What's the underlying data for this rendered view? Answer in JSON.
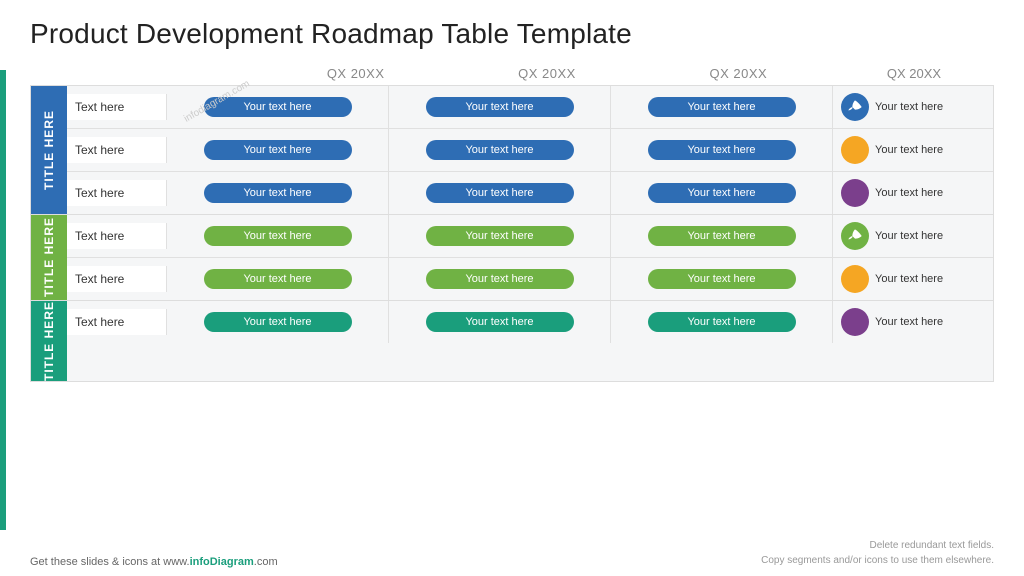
{
  "title": "Product Development Roadmap Table Template",
  "watermark": "infodiagram.com",
  "col_headers": [
    "QX 20XX",
    "QX 20XX",
    "QX 20XX",
    "QX 20XX"
  ],
  "sections": [
    {
      "id": "section-1",
      "title_label": "Title Here",
      "color": "blue",
      "rows": [
        {
          "label": "Text here",
          "cells": [
            "Your text here",
            "Your text here",
            "Your text here"
          ],
          "icon_type": "rocket",
          "icon_color": "blue",
          "last_text": "Your text here"
        },
        {
          "label": "Text here",
          "cells": [
            "Your text here",
            "Your text here",
            "Your text here"
          ],
          "icon_type": "circle",
          "icon_color": "orange",
          "last_text": "Your text here"
        },
        {
          "label": "Text here",
          "cells": [
            "Your text here",
            "Your text here",
            "Your text here"
          ],
          "icon_type": "circle",
          "icon_color": "purple",
          "last_text": "Your text here"
        }
      ]
    },
    {
      "id": "section-2",
      "title_label": "Title Here",
      "color": "green",
      "rows": [
        {
          "label": "Text here",
          "cells": [
            "Your text here",
            "Your text here",
            "Your text here"
          ],
          "icon_type": "rocket",
          "icon_color": "green",
          "last_text": "Your text here"
        },
        {
          "label": "Text here",
          "cells": [
            "Your text here",
            "Your text here",
            "Your text here"
          ],
          "icon_type": "circle",
          "icon_color": "orange",
          "last_text": "Your text here"
        }
      ]
    },
    {
      "id": "section-3",
      "title_label": "Title Here",
      "color": "teal",
      "rows": [
        {
          "label": "Text here",
          "cells": [
            "Your text here",
            "Your text here",
            "Your text here"
          ],
          "icon_type": "circle",
          "icon_color": "purple",
          "last_text": "Your text here"
        }
      ]
    }
  ],
  "footer": {
    "left": "Get these slides & icons at www.",
    "brand": "infoDiagram",
    "left_suffix": ".com",
    "right_line1": "Delete redundant text fields.",
    "right_line2": "Copy segments and/or icons to use them elsewhere."
  }
}
